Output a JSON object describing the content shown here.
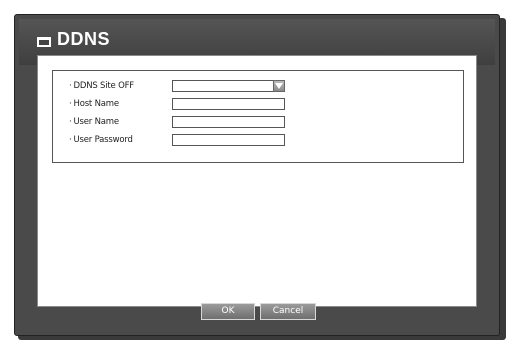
{
  "dialog": {
    "title": "DDNS",
    "title_icon": "window-icon"
  },
  "fields": [
    {
      "label": "DDNS Site",
      "value": "OFF",
      "type": "select"
    },
    {
      "label": "Host Name",
      "value": "",
      "type": "text"
    },
    {
      "label": "User Name",
      "value": "",
      "type": "text"
    },
    {
      "label": "User Password",
      "value": "",
      "type": "password"
    }
  ],
  "buttons": {
    "ok": "OK",
    "cancel": "Cancel"
  },
  "colors": {
    "frame": "#4a4a4a",
    "button": "#7f7f7f"
  }
}
